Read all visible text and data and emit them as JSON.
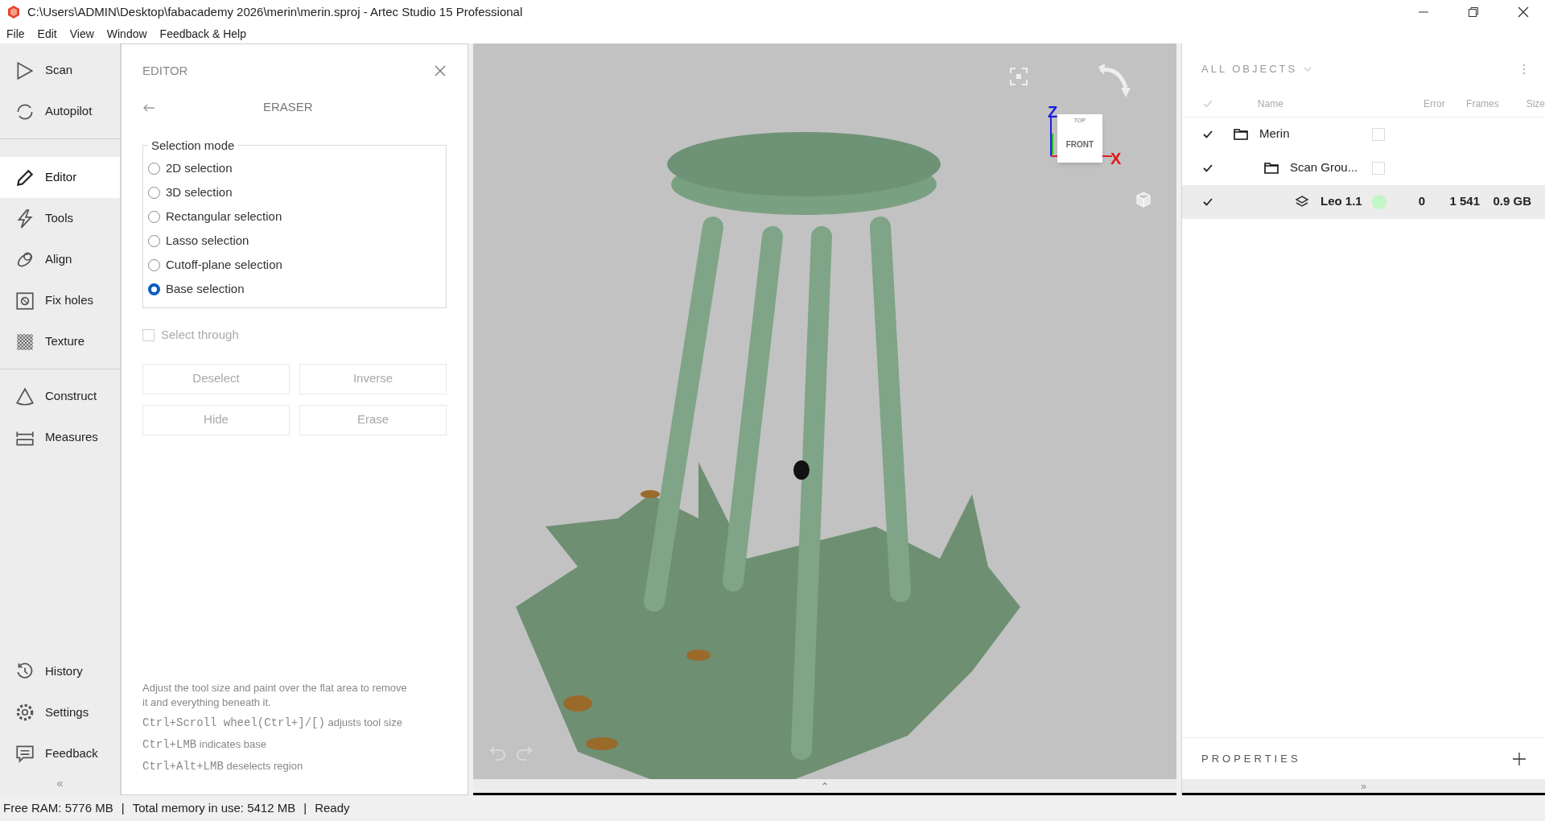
{
  "window": {
    "title": "C:\\Users\\ADMIN\\Desktop\\fabacademy 2026\\merin\\merin.sproj - Artec Studio 15 Professional"
  },
  "menu": [
    "File",
    "Edit",
    "View",
    "Window",
    "Feedback & Help"
  ],
  "sidebar": {
    "groups": [
      [
        {
          "label": "Scan",
          "selected": false
        },
        {
          "label": "Autopilot",
          "selected": false
        }
      ],
      [
        {
          "label": "Editor",
          "selected": true
        },
        {
          "label": "Tools",
          "selected": false
        },
        {
          "label": "Align",
          "selected": false
        },
        {
          "label": "Fix holes",
          "selected": false
        },
        {
          "label": "Texture",
          "selected": false
        }
      ],
      [
        {
          "label": "Construct",
          "selected": false
        },
        {
          "label": "Measures",
          "selected": false
        }
      ]
    ],
    "bottom": [
      {
        "label": "History",
        "selected": false
      },
      {
        "label": "Settings",
        "selected": false
      },
      {
        "label": "Feedback",
        "selected": false
      }
    ],
    "collapse": "«"
  },
  "editor": {
    "title": "EDITOR",
    "tool": "ERASER",
    "selection_mode": {
      "label": "Selection mode",
      "options": [
        {
          "label": "2D selection",
          "selected": false
        },
        {
          "label": "3D selection",
          "selected": false
        },
        {
          "label": "Rectangular selection",
          "selected": false
        },
        {
          "label": "Lasso selection",
          "selected": false
        },
        {
          "label": "Cutoff-plane selection",
          "selected": false
        },
        {
          "label": "Base selection",
          "selected": true
        }
      ]
    },
    "select_through": {
      "label": "Select through",
      "checked": false,
      "disabled": true
    },
    "buttons": [
      {
        "label": "Deselect",
        "disabled": true
      },
      {
        "label": "Inverse",
        "disabled": true
      },
      {
        "label": "Hide",
        "disabled": true
      },
      {
        "label": "Erase",
        "disabled": true
      }
    ],
    "help": "Adjust the tool size and paint over the flat area to remove it and everything beneath it.",
    "shortcuts": [
      {
        "keys": "Ctrl+Scroll wheel(Ctrl+]/[)",
        "text": "adjusts tool size"
      },
      {
        "keys": "Ctrl+LMB",
        "text": "indicates base"
      },
      {
        "keys": "Ctrl+Alt+LMB",
        "text": "deselects region"
      }
    ]
  },
  "viewport": {
    "axes": {
      "z": "Z",
      "x": "X"
    },
    "cube": {
      "top": "TOP",
      "front": "FRONT"
    },
    "expand": "⌃"
  },
  "objects": {
    "title": "ALL OBJECTS",
    "columns": [
      "Name",
      "Error",
      "Frames",
      "Size"
    ],
    "tree": [
      {
        "name": "Merin",
        "kind": "folder",
        "checked": true,
        "selected": false,
        "children": [
          {
            "name": "Scan Grou...",
            "kind": "folder",
            "checked": true,
            "selected": false,
            "children": [
              {
                "name": "Leo 1.1",
                "kind": "scan",
                "checked": true,
                "selected": true,
                "color": "#c4f5c4",
                "error": "0",
                "frames": "1 541",
                "size": "0.9 GB"
              }
            ]
          }
        ]
      }
    ]
  },
  "properties": {
    "title": "PROPERTIES",
    "expand": "»"
  },
  "status_bar": [
    "Free RAM: 5776 MB",
    "|",
    "Total memory in use: 5412 MB",
    "|",
    "Ready"
  ]
}
